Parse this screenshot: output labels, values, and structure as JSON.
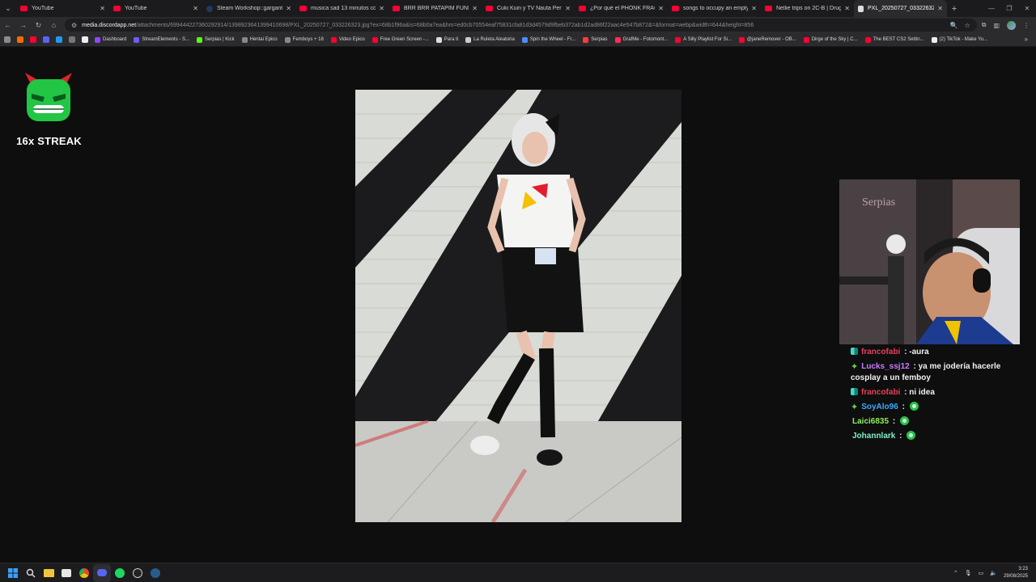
{
  "tabs": [
    {
      "title": "YouTube",
      "icon": "youtube-icon",
      "active": false
    },
    {
      "title": "YouTube",
      "icon": "youtube-icon",
      "active": false
    },
    {
      "title": "Steam Workshop::gargantua",
      "icon": "steam-icon",
      "active": false
    },
    {
      "title": "musica sad 13 minutos con b",
      "icon": "youtube-icon",
      "active": false
    },
    {
      "title": "BRR BRR PATAPIM FUNK - Yo",
      "icon": "youtube-icon",
      "active": false
    },
    {
      "title": "Cuki Kuin y TV Nauta Pero Al",
      "icon": "youtube-icon",
      "active": false
    },
    {
      "title": "¿Por qué el PHONK FRACASÓ",
      "icon": "youtube-icon",
      "active": false
    },
    {
      "title": "songs to occupy an empty m",
      "icon": "youtube-icon",
      "active": false
    },
    {
      "title": "Nellie trips on 2C-B | Drugsli",
      "icon": "youtube-icon",
      "active": false
    },
    {
      "title": "PXL_20250727_033226323.jpg",
      "icon": "image-page-icon",
      "active": true
    }
  ],
  "address": {
    "host": "media.discordapp.net",
    "path": "/attachments/699444227360292914/1398923641399410698/PXL_20250727_033226323.jpg?ex=68b1f96a&is=68b0a7ea&hm=ed0cb70554eaf75831cfa81d3d4579d9fbeb372ab1d2ad86f22aac4e547b872&=&format=webp&width=644&height=856"
  },
  "bookmarks": [
    {
      "label": "Dashboard",
      "color": "#9146ff"
    },
    {
      "label": "StreamElements - S...",
      "color": "#6a5cff"
    },
    {
      "label": "Serpias | Kick",
      "color": "#53fc18"
    },
    {
      "label": "Hentai Epico",
      "color": "#888888"
    },
    {
      "label": "Femboys + 18",
      "color": "#888888"
    },
    {
      "label": "Video Epico",
      "color": "#ff0033"
    },
    {
      "label": "Free Green Screen -...",
      "color": "#ff0033"
    },
    {
      "label": "Para ti",
      "color": "#dddddd"
    },
    {
      "label": "La Ruleta Aleatoria",
      "color": "#cccccc"
    },
    {
      "label": "Spin the Wheel - Fr...",
      "color": "#4f8bff"
    },
    {
      "label": "Serpias",
      "color": "#ff3b3b"
    },
    {
      "label": "GrafMe - Fotomont...",
      "color": "#ff2d55"
    },
    {
      "label": "A Silly Playlist For Si...",
      "color": "#ff0033"
    },
    {
      "label": "@janeRemover - OB...",
      "color": "#ff0033"
    },
    {
      "label": "Dirge of the Sky | C...",
      "color": "#ff0033"
    },
    {
      "label": "The BEST CS2 Settin...",
      "color": "#ff0033"
    },
    {
      "label": "(2) TikTok - Make Yo...",
      "color": "#eeeeee"
    }
  ],
  "streak": {
    "label": "16x STREAK"
  },
  "chat": [
    {
      "badge": "streamer",
      "user": "francofabi",
      "color": "#e6405a",
      "text": "-aura",
      "emote": false
    },
    {
      "badge": "plus",
      "user": "Lucks_ssj12",
      "color": "#c77dff",
      "text": "ya me jodería hacerle cosplay a un femboy",
      "emote": false
    },
    {
      "badge": "streamer",
      "user": "francofabi",
      "color": "#e6405a",
      "text": "ni idea",
      "emote": false
    },
    {
      "badge": "plus",
      "user": "SoyAlo96",
      "color": "#3ea8ff",
      "text": "",
      "emote": true
    },
    {
      "badge": "",
      "user": "Laici6835",
      "color": "#8cf05a",
      "text": "",
      "emote": true
    },
    {
      "badge": "",
      "user": "Johannlark",
      "color": "#7ef0c8",
      "text": "",
      "emote": true
    }
  ],
  "clock": {
    "time": "3:23",
    "date": "29/08/2025"
  },
  "icons": {
    "menu": "tab-search-icon",
    "newtab": "plus-icon",
    "back": "arrow-left-icon",
    "forward": "arrow-right-icon",
    "reload": "reload-icon",
    "home": "home-icon"
  }
}
